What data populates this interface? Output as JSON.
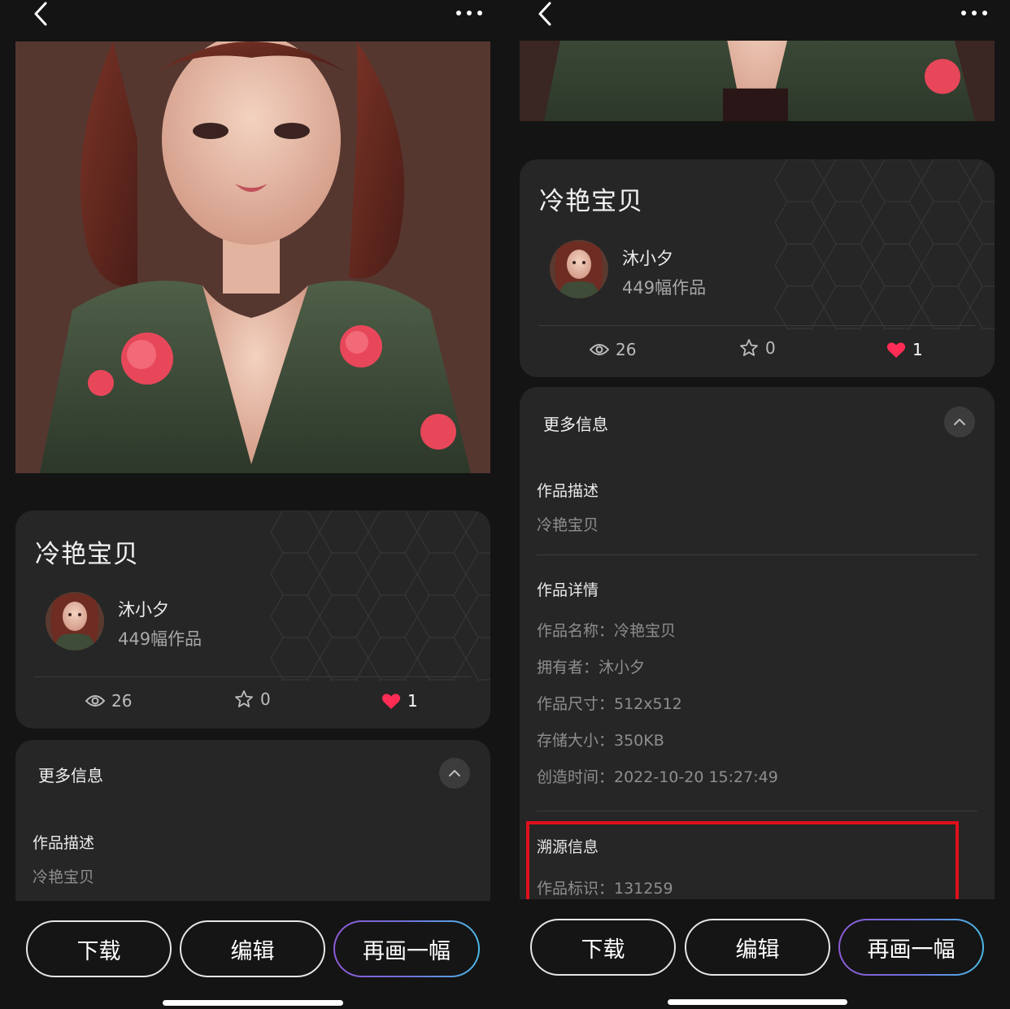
{
  "artwork": {
    "title": "冷艳宝贝",
    "author": "沐小夕",
    "works_count": "449幅作品",
    "views": "26",
    "favorites": "0",
    "likes": "1"
  },
  "more_info": {
    "header": "更多信息",
    "description_label": "作品描述",
    "description_value": "冷艳宝贝",
    "details_label": "作品详情",
    "details": [
      "作品名称：冷艳宝贝",
      "拥有者：沐小夕",
      "作品尺寸：512x512",
      "存储大小：350KB",
      "创造时间：2022-10-20 15:27:49"
    ],
    "trace_label": "溯源信息",
    "trace_id": "作品标识：131259"
  },
  "actions": {
    "download": "下载",
    "edit": "编辑",
    "redraw": "再画一幅"
  },
  "colors": {
    "background": "#141414",
    "card": "#262626",
    "like": "#ff2d55",
    "highlight_box": "#e0101c"
  },
  "icons": [
    "back-arrow-icon",
    "more-dots-icon",
    "eye-icon",
    "star-icon",
    "heart-icon",
    "chevron-up-icon"
  ]
}
